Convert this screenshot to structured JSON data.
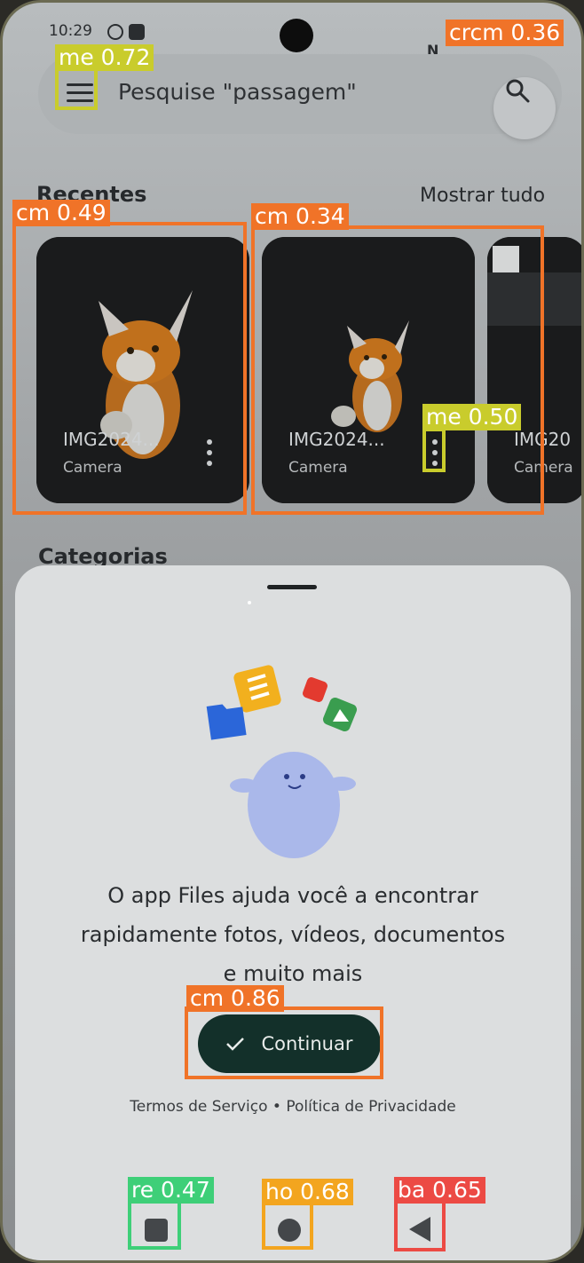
{
  "status": {
    "time": "10:29"
  },
  "search": {
    "placeholder": "Pesquise \"passagem\""
  },
  "recents": {
    "title": "Recentes",
    "show_all": "Mostrar tudo",
    "cards": [
      {
        "name": "IMG2024...",
        "source": "Camera"
      },
      {
        "name": "IMG2024...",
        "source": "Camera"
      },
      {
        "name": "IMG20",
        "source": "Camera"
      }
    ]
  },
  "categories": {
    "title": "Categorias"
  },
  "sheet": {
    "line1": "O app Files ajuda você a encontrar",
    "line2": "rapidamente fotos, vídeos, documentos",
    "line3": "e muito mais",
    "continue_label": "Continuar",
    "terms": "Termos de Serviço • Política de Privacidade"
  },
  "detections": {
    "d1": "crcm 0.36",
    "d2": "me 0.72",
    "d3": "cm 0.49",
    "d4": "cm 0.34",
    "d5": "me 0.50",
    "d6": "cm 0.86",
    "d7": "re 0.47",
    "d8": "ho 0.68",
    "d9": "ba 0.65"
  },
  "colors": {
    "overlay_orange": "#f07328",
    "overlay_yellow": "#c9cc2c",
    "overlay_green": "#3ecf78",
    "overlay_amber": "#f3a51f",
    "overlay_red": "#ec4a44",
    "continue_bg": "#13302a"
  },
  "icons": [
    "menu-icon",
    "search-icon",
    "more-vert-icon",
    "check-icon",
    "recents-nav-icon",
    "home-nav-icon",
    "back-nav-icon"
  ]
}
